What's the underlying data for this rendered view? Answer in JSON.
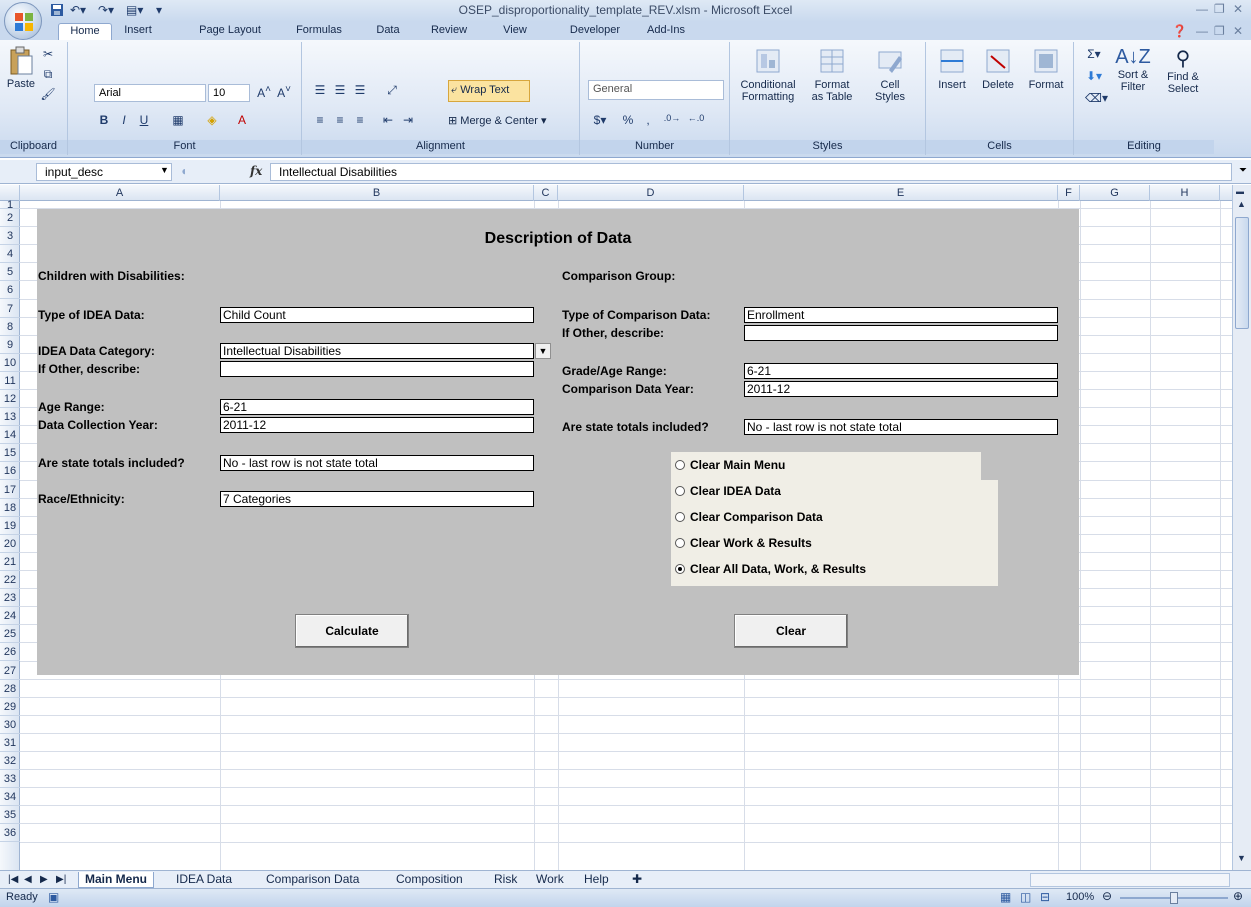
{
  "window": {
    "title": "OSEP_disproportionality_template_REV.xlsm - Microsoft Excel"
  },
  "ribbon": {
    "tabs": [
      "Home",
      "Insert",
      "Page Layout",
      "Formulas",
      "Data",
      "Review",
      "View",
      "Developer",
      "Add-Ins"
    ],
    "active_tab": "Home",
    "groups": {
      "clipboard": "Clipboard",
      "font": "Font",
      "alignment": "Alignment",
      "number": "Number",
      "styles": "Styles",
      "cells": "Cells",
      "editing": "Editing"
    },
    "paste": "Paste",
    "font_name": "Arial",
    "font_size": "10",
    "wrap_text": "Wrap Text",
    "merge_center": "Merge & Center",
    "number_format": "General",
    "conditional_formatting_1": "Conditional",
    "conditional_formatting_2": "Formatting",
    "format_table_1": "Format",
    "format_table_2": "as Table",
    "cell_styles_1": "Cell",
    "cell_styles_2": "Styles",
    "insert": "Insert",
    "delete": "Delete",
    "format": "Format",
    "sort_filter_1": "Sort &",
    "sort_filter_2": "Filter",
    "find_select_1": "Find &",
    "find_select_2": "Select"
  },
  "formula_bar": {
    "name_box": "input_desc",
    "fx": "fx",
    "formula": "Intellectual Disabilities"
  },
  "columns": [
    "A",
    "B",
    "C",
    "D",
    "E",
    "F",
    "G",
    "H"
  ],
  "rows": [
    "1",
    "2",
    "3",
    "4",
    "5",
    "6",
    "7",
    "8",
    "9",
    "10",
    "11",
    "12",
    "13",
    "14",
    "15",
    "16",
    "17",
    "18",
    "19",
    "20",
    "21",
    "22",
    "23",
    "24",
    "25",
    "26",
    "27",
    "28",
    "29",
    "30",
    "31",
    "32",
    "33",
    "34",
    "35",
    "36"
  ],
  "sheet": {
    "heading": "Description of Data",
    "left": {
      "section": "Children with Disabilities:",
      "type_label": "Type of IDEA Data:",
      "type_value": "Child Count",
      "category_label": "IDEA Data Category:",
      "category_value": "Intellectual Disabilities",
      "other_label": "If Other, describe:",
      "other_value": "",
      "age_label": "Age Range:",
      "age_value": "6-21",
      "year_label": "Data Collection Year:",
      "year_value": "2011-12",
      "totals_label": "Are state totals included?",
      "totals_value": "No - last row is not state total",
      "race_label": "Race/Ethnicity:",
      "race_value": "7 Categories"
    },
    "right": {
      "section": "Comparison Group:",
      "type_label": "Type of Comparison Data:",
      "type_value": "Enrollment",
      "other_label": "If Other, describe:",
      "other_value": "",
      "grade_label": "Grade/Age Range:",
      "grade_value": "6-21",
      "year_label": "Comparison Data Year:",
      "year_value": "2011-12",
      "totals_label": "Are state totals included?",
      "totals_value": "No - last row is not state total"
    },
    "radio_options": [
      {
        "label": "Clear Main Menu",
        "selected": false
      },
      {
        "label": "Clear IDEA Data",
        "selected": false
      },
      {
        "label": "Clear Comparison Data",
        "selected": false
      },
      {
        "label": "Clear Work & Results",
        "selected": false
      },
      {
        "label": "Clear All Data, Work, & Results",
        "selected": true
      }
    ],
    "calculate_button": "Calculate",
    "clear_button": "Clear"
  },
  "sheet_tabs": [
    "Main Menu",
    "IDEA Data",
    "Comparison Data",
    "Composition",
    "Risk",
    "Work",
    "Help"
  ],
  "active_sheet": "Main Menu",
  "status": {
    "ready": "Ready",
    "zoom": "100%"
  }
}
